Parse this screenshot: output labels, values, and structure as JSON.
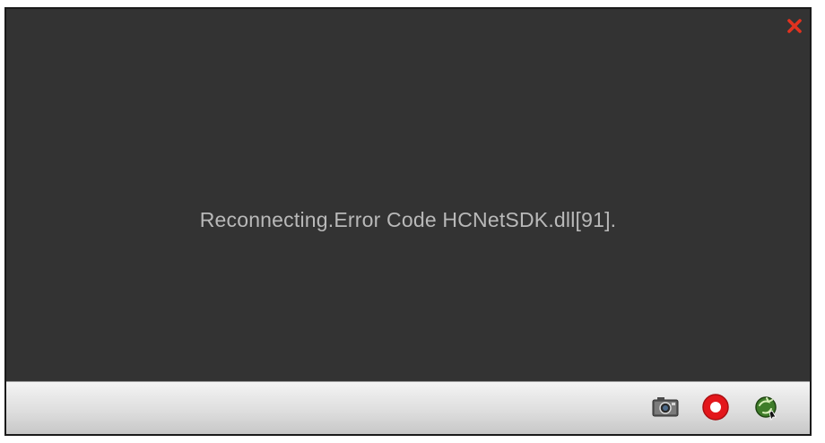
{
  "player": {
    "status_message": "Reconnecting.Error Code HCNetSDK.dll[91].",
    "colors": {
      "video_bg": "#333333",
      "message_text": "#b9b9b9",
      "close_red": "#e0321f",
      "record_red": "#e3161b"
    },
    "toolbar": {
      "buttons": [
        {
          "name": "snapshot",
          "icon": "camera-icon"
        },
        {
          "name": "record",
          "icon": "record-icon"
        },
        {
          "name": "refresh",
          "icon": "refresh-icon"
        }
      ]
    }
  }
}
